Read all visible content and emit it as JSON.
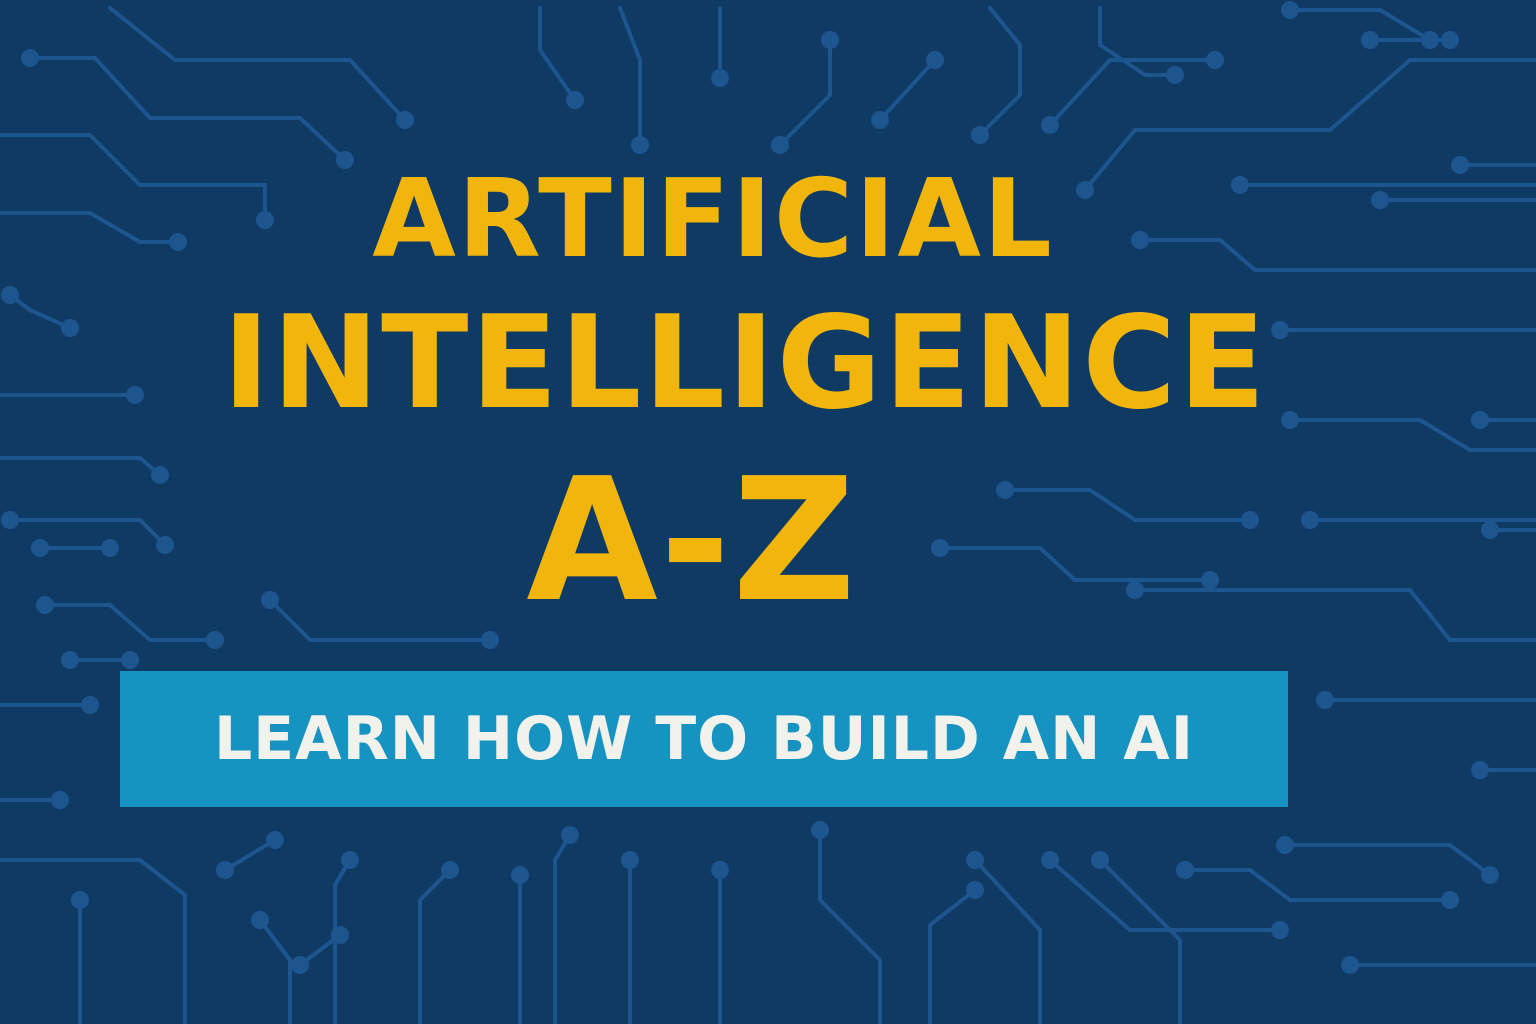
{
  "colors": {
    "background": "#0e3a63",
    "circuit": "#1d558f",
    "title": "#f2b50c",
    "banner": "#1693c0",
    "banner_text": "#f2f2ec"
  },
  "title": {
    "line1": "ARTIFICIAL",
    "line2": "INTELLIGENCE",
    "line3": "A-Z"
  },
  "subtitle": {
    "text": "LEARN HOW TO BUILD AN AI"
  },
  "background": {
    "pattern": "circuit-traces"
  }
}
